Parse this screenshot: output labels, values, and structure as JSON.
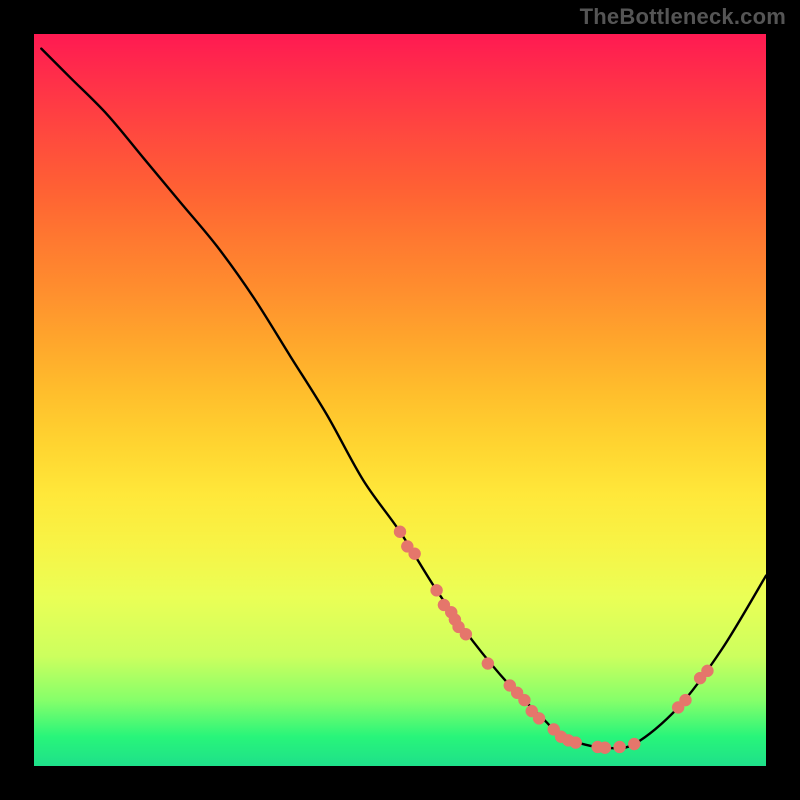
{
  "watermark": "TheBottleneck.com",
  "chart_data": {
    "type": "line",
    "title": "",
    "xlabel": "",
    "ylabel": "",
    "xlim": [
      0,
      100
    ],
    "ylim": [
      0,
      100
    ],
    "curve": {
      "x": [
        1,
        5,
        10,
        15,
        20,
        25,
        30,
        35,
        40,
        45,
        50,
        55,
        60,
        65,
        70,
        72,
        75,
        78,
        82,
        88,
        94,
        100
      ],
      "y": [
        98,
        94,
        89,
        83,
        77,
        71,
        64,
        56,
        48,
        39,
        32,
        24,
        17,
        11,
        6,
        4,
        3,
        2.5,
        3,
        8,
        16,
        26
      ]
    },
    "dots": [
      {
        "x": 50,
        "y": 32
      },
      {
        "x": 51,
        "y": 30
      },
      {
        "x": 52,
        "y": 29
      },
      {
        "x": 55,
        "y": 24
      },
      {
        "x": 56,
        "y": 22
      },
      {
        "x": 57,
        "y": 21
      },
      {
        "x": 57.5,
        "y": 20
      },
      {
        "x": 58,
        "y": 19
      },
      {
        "x": 59,
        "y": 18
      },
      {
        "x": 62,
        "y": 14
      },
      {
        "x": 65,
        "y": 11
      },
      {
        "x": 66,
        "y": 10
      },
      {
        "x": 67,
        "y": 9
      },
      {
        "x": 68,
        "y": 7.5
      },
      {
        "x": 69,
        "y": 6.5
      },
      {
        "x": 71,
        "y": 5
      },
      {
        "x": 72,
        "y": 4
      },
      {
        "x": 73,
        "y": 3.5
      },
      {
        "x": 74,
        "y": 3.2
      },
      {
        "x": 77,
        "y": 2.6
      },
      {
        "x": 78,
        "y": 2.5
      },
      {
        "x": 80,
        "y": 2.6
      },
      {
        "x": 82,
        "y": 3
      },
      {
        "x": 88,
        "y": 8
      },
      {
        "x": 89,
        "y": 9
      },
      {
        "x": 91,
        "y": 12
      },
      {
        "x": 92,
        "y": 13
      }
    ]
  }
}
